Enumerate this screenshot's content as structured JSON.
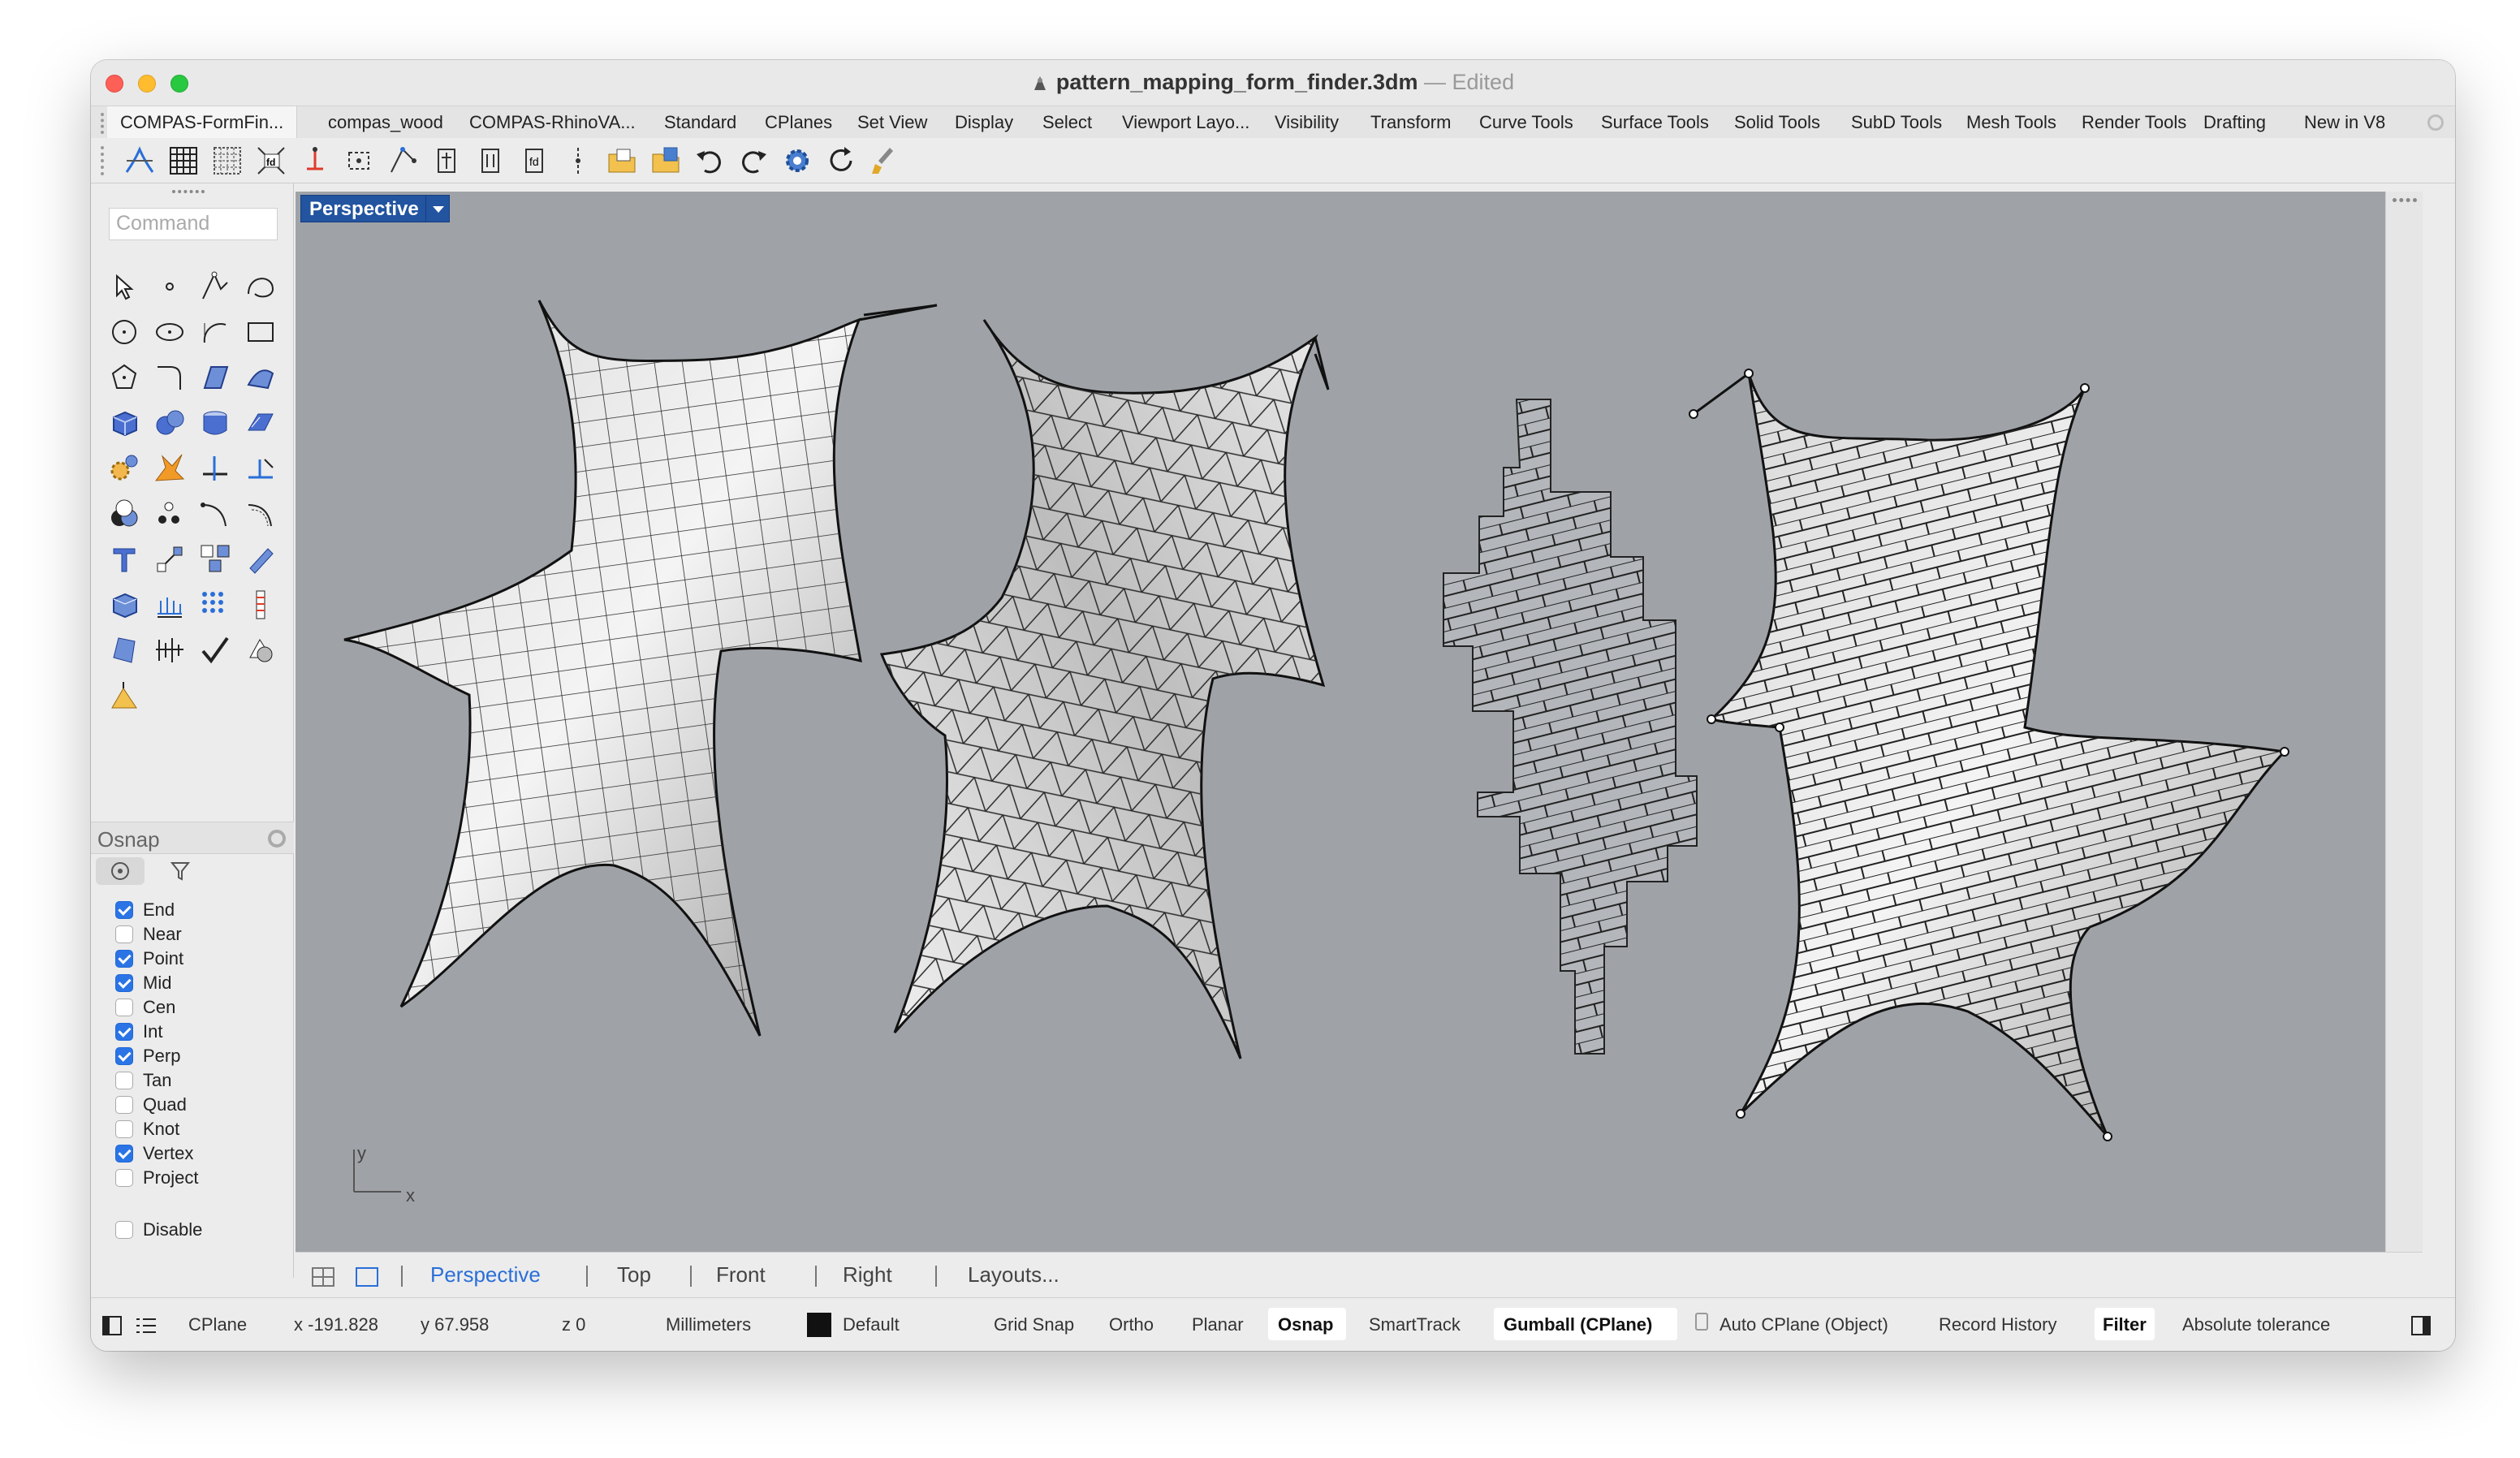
{
  "window": {
    "title": "pattern_mapping_form_finder.3dm",
    "title_separator": "—",
    "status": "Edited"
  },
  "tabs": [
    "COMPAS-FormFin...",
    "compas_wood",
    "COMPAS-RhinoVA...",
    "Standard",
    "CPlanes",
    "Set View",
    "Display",
    "Select",
    "Viewport Layo...",
    "Visibility",
    "Transform",
    "Curve Tools",
    "Surface Tools",
    "Solid Tools",
    "SubD Tools",
    "Mesh Tools",
    "Render Tools",
    "Drafting",
    "New in V8"
  ],
  "toolbar_icons": [
    "formfinder-icon",
    "grid-icon",
    "pattern-grid-icon",
    "fd-icon",
    "anchor-icon",
    "mesh-select-icon",
    "edges-icon",
    "vertex-move-icon",
    "vertex-edit-icon",
    "vertex-attr-icon",
    "split-icon",
    "open-file-icon",
    "export-icon",
    "undo-icon",
    "redo-icon",
    "settings-gear-icon",
    "refresh-icon",
    "paint-brush-icon"
  ],
  "command": {
    "placeholder": "Command"
  },
  "osnap": {
    "title": "Osnap",
    "items": [
      {
        "label": "End",
        "checked": true
      },
      {
        "label": "Near",
        "checked": false
      },
      {
        "label": "Point",
        "checked": true
      },
      {
        "label": "Mid",
        "checked": true
      },
      {
        "label": "Cen",
        "checked": false
      },
      {
        "label": "Int",
        "checked": true
      },
      {
        "label": "Perp",
        "checked": true
      },
      {
        "label": "Tan",
        "checked": false
      },
      {
        "label": "Quad",
        "checked": false
      },
      {
        "label": "Knot",
        "checked": false
      },
      {
        "label": "Vertex",
        "checked": true
      },
      {
        "label": "Project",
        "checked": false
      }
    ],
    "disable": {
      "label": "Disable",
      "checked": false
    }
  },
  "viewport": {
    "label": "Perspective",
    "axis_x": "x",
    "axis_y": "y"
  },
  "viewport_tabs": [
    "Perspective",
    "Top",
    "Front",
    "Right",
    "Layouts..."
  ],
  "status": {
    "cplane": "CPlane",
    "x": "x -191.828",
    "y": "y 67.958",
    "z": "z 0",
    "units": "Millimeters",
    "layer": "Default",
    "grid_snap": "Grid Snap",
    "ortho": "Ortho",
    "planar": "Planar",
    "osnap": "Osnap",
    "smarttrack": "SmartTrack",
    "gumball": "Gumball (CPlane)",
    "auto_cplane": "Auto CPlane (Object)",
    "record_history": "Record History",
    "filter": "Filter",
    "tolerance": "Absolute tolerance"
  },
  "colors": {
    "viewport_bg": "#9fa3a8",
    "active_blue": "#2254a0",
    "checkbox_blue": "#2a74e6",
    "active_tab_text": "#2a6fd8"
  }
}
